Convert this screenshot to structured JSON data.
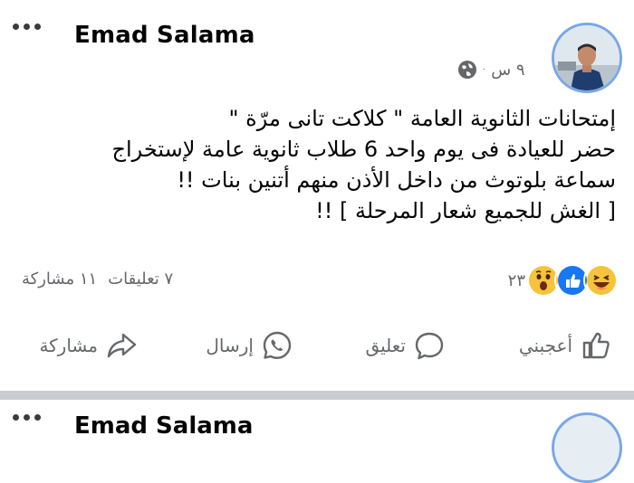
{
  "post": {
    "author": "Emad Salama",
    "time": "٩ س",
    "separator": "·",
    "privacy_icon": "globe-icon",
    "text_lines": [
      "إمتحانات الثانوية العامة \" كلاكت تانى مرّة \"",
      "حضر للعيادة فى يوم واحد 6 طلاب ثانوية عامة لإستخراج",
      "سماعة بلوتوث من داخل الأذن منهم أتنين بنات !!",
      "[ الغش للجميع شعار المرحلة ] !!"
    ],
    "reactions": {
      "icons": [
        "haha-icon",
        "like-icon",
        "wow-icon"
      ],
      "count": "٢٣"
    },
    "comments": "٧ تعليقات",
    "shares": "١١ مشاركة"
  },
  "actions": {
    "like": "أعجبني",
    "comment": "تعليق",
    "send": "إرسال",
    "share": "مشاركة"
  },
  "next_post": {
    "author": "Emad Salama"
  },
  "colors": {
    "text": "#050505",
    "secondary": "#65676b",
    "divider": "#c9ccd1",
    "like_blue": "#1877f2",
    "avatar_ring": "#7aa7e6"
  }
}
